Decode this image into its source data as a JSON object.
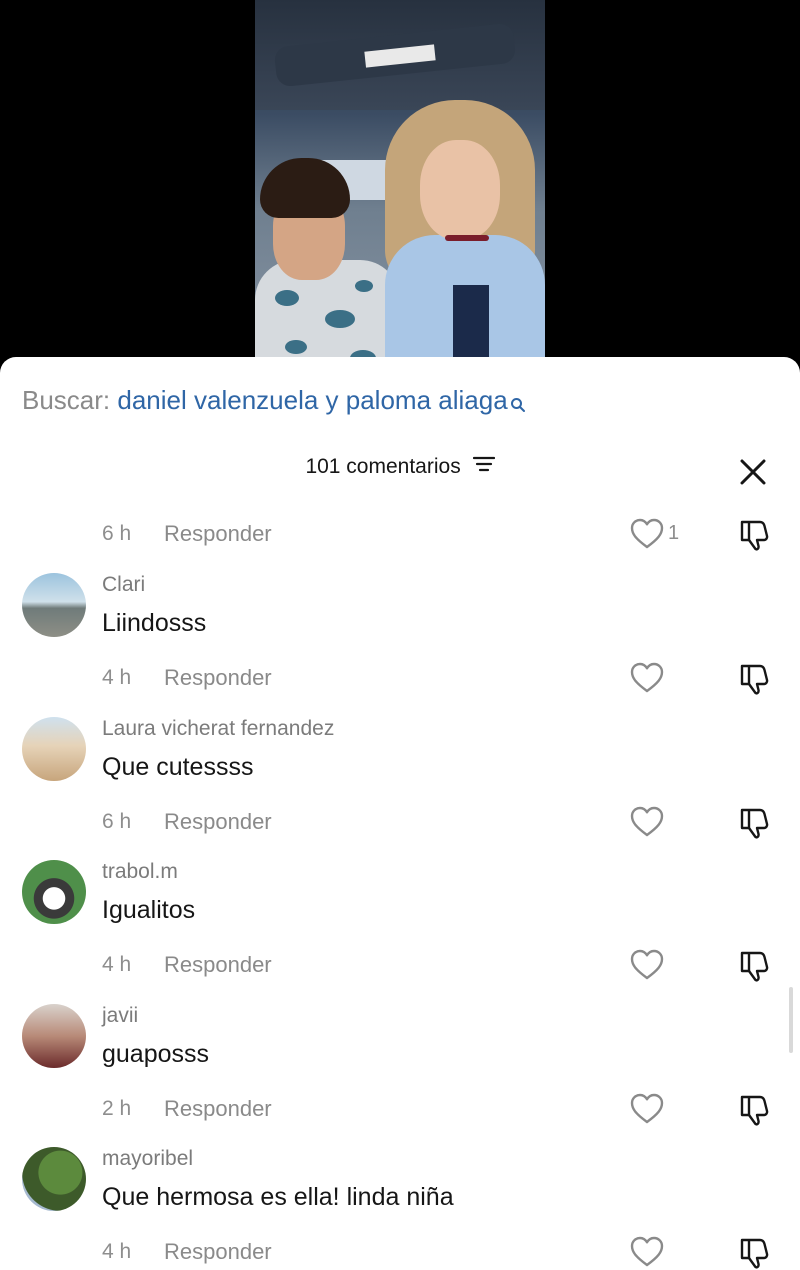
{
  "search": {
    "prefix": "Buscar:",
    "query": "daniel valenzuela y paloma aliaga"
  },
  "header": {
    "title": "101 comentarios"
  },
  "first_meta": {
    "time": "6 h",
    "reply": "Responder",
    "likes": "1"
  },
  "comments": [
    {
      "user": "Clari",
      "text": "Liindosss",
      "time": "4 h",
      "reply": "Responder"
    },
    {
      "user": "Laura vicherat fernandez",
      "text": "Que cutessss",
      "time": "6 h",
      "reply": "Responder"
    },
    {
      "user": "trabol.m",
      "text": "Igualitos",
      "time": "4 h",
      "reply": "Responder"
    },
    {
      "user": "javii",
      "text": "guaposss",
      "time": "2 h",
      "reply": "Responder"
    },
    {
      "user": "mayoribel",
      "text": "Que hermosa es ella! linda niña",
      "time": "4 h",
      "reply": "Responder"
    }
  ],
  "icons": {
    "search": "search-icon",
    "filter": "filter-icon",
    "close": "close-icon",
    "like": "heart-icon",
    "dislike": "thumbs-down-icon"
  },
  "colors": {
    "query_link": "#2f66a6",
    "muted_text": "#8a8a8a",
    "primary_text": "#161616"
  }
}
